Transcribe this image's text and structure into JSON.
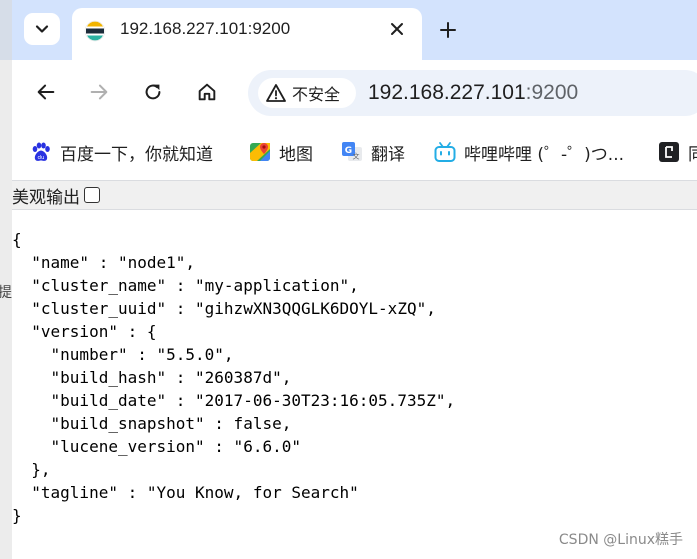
{
  "side_window": {
    "partial_char": "提"
  },
  "tab": {
    "title": "192.168.227.101:9200"
  },
  "omnibox": {
    "security_label": "不安全",
    "url_host": "192.168.227.101",
    "url_port": ":9200"
  },
  "bookmarks": [
    {
      "label": "百度一下，你就知道",
      "icon": "baidu-paw-icon"
    },
    {
      "label": "地图",
      "icon": "google-maps-icon"
    },
    {
      "label": "翻译",
      "icon": "google-translate-icon"
    },
    {
      "label": "哔哩哔哩 (゜-゜)つ...",
      "icon": "bilibili-icon"
    },
    {
      "label": "同",
      "icon": "dark-square-icon"
    }
  ],
  "pretty_print": {
    "label": "美观输出",
    "checked": false
  },
  "json_text": "{\n  \"name\" : \"node1\",\n  \"cluster_name\" : \"my-application\",\n  \"cluster_uuid\" : \"gihzwXN3QQGLK6DOYL-xZQ\",\n  \"version\" : {\n    \"number\" : \"5.5.0\",\n    \"build_hash\" : \"260387d\",\n    \"build_date\" : \"2017-06-30T23:16:05.735Z\",\n    \"build_snapshot\" : false,\n    \"lucene_version\" : \"6.6.0\"\n  },\n  \"tagline\" : \"You Know, for Search\"\n}",
  "watermark": "CSDN @Linux糕手",
  "colors": {
    "tabstrip": "#d3e3fd",
    "omnibox": "#edf2fa"
  }
}
